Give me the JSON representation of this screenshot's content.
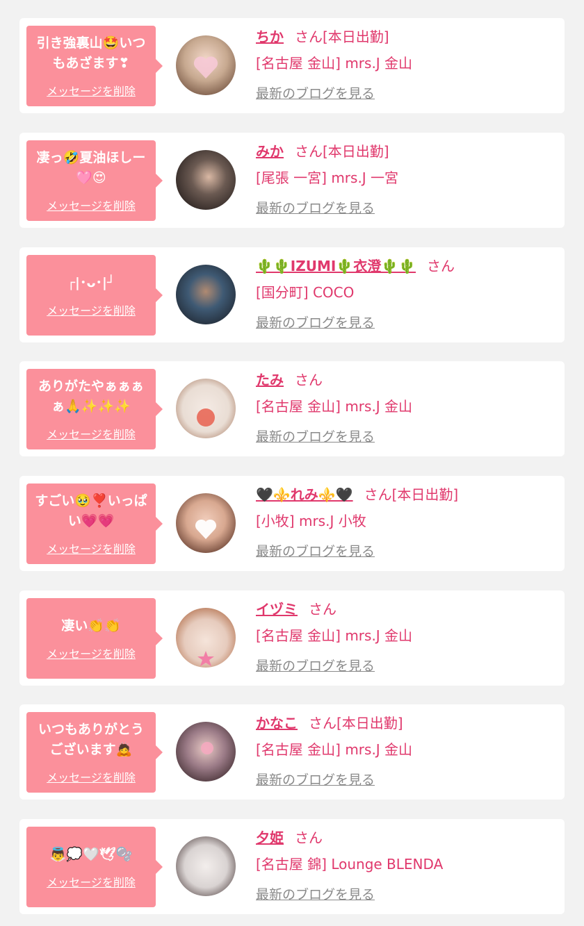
{
  "cards": [
    {
      "message": "引き強裏山🤩いつもあざます❣",
      "delete_label": "メッセージを削除",
      "name": "ちか",
      "suffix": "さん[本日出勤]",
      "shop": "[名古屋 金山] mrs.J 金山",
      "blog_link": "最新のブログを見る",
      "avatar_colors": [
        "#c7a990",
        "#7a5a47"
      ]
    },
    {
      "message": "凄っ🤣夏油ほしー🩷😍",
      "delete_label": "メッセージを削除",
      "name": "みか",
      "suffix": "さん[本日出勤]",
      "shop": "[尾張 一宮] mrs.J 一宮",
      "blog_link": "最新のブログを見る",
      "avatar_colors": [
        "#6b5a52",
        "#2a2220"
      ]
    },
    {
      "message": "┌|･ᴗ･|┘",
      "delete_label": "メッセージを削除",
      "name": "🌵🌵IZUMI🌵衣澄🌵🌵",
      "suffix": "さん",
      "shop": "[国分町] COCO",
      "blog_link": "最新のブログを見る",
      "avatar_colors": [
        "#3f5a74",
        "#1f2630"
      ]
    },
    {
      "message": "ありがたやぁぁぁぁ🙏✨✨✨",
      "delete_label": "メッセージを削除",
      "name": "たみ",
      "suffix": "さん",
      "shop": "[名古屋 金山] mrs.J 金山",
      "blog_link": "最新のブログを見る",
      "avatar_colors": [
        "#e9ddd4",
        "#a87b62"
      ]
    },
    {
      "message": "すごい🥹❣️いっぱい💗💗",
      "delete_label": "メッセージを削除",
      "name": "🖤⚜️れみ⚜️🖤",
      "suffix": "さん[本日出勤]",
      "shop": "[小牧] mrs.J 小牧",
      "blog_link": "最新のブログを見る",
      "avatar_colors": [
        "#d8a890",
        "#5a3326"
      ]
    },
    {
      "message": "凄い👏👏",
      "delete_label": "メッセージを削除",
      "name": "イヅミ",
      "suffix": "さん",
      "shop": "[名古屋 金山] mrs.J 金山",
      "blog_link": "最新のブログを見る",
      "avatar_colors": [
        "#e6cbbd",
        "#b06a45"
      ]
    },
    {
      "message": "いつもありがとうございます🙇",
      "delete_label": "メッセージを削除",
      "name": "かなこ",
      "suffix": "さん[本日出勤]",
      "shop": "[名古屋 金山] mrs.J 金山",
      "blog_link": "最新のブログを見る",
      "avatar_colors": [
        "#9a7a86",
        "#3e2a2e"
      ]
    },
    {
      "message": "👼💭🤍🕊🫧",
      "delete_label": "メッセージを削除",
      "name": "夕姫",
      "suffix": "さん",
      "shop": "[名古屋 錦] Lounge BLENDA",
      "blog_link": "最新のブログを見る",
      "avatar_colors": [
        "#d9d3d2",
        "#4a3a3a"
      ]
    }
  ]
}
